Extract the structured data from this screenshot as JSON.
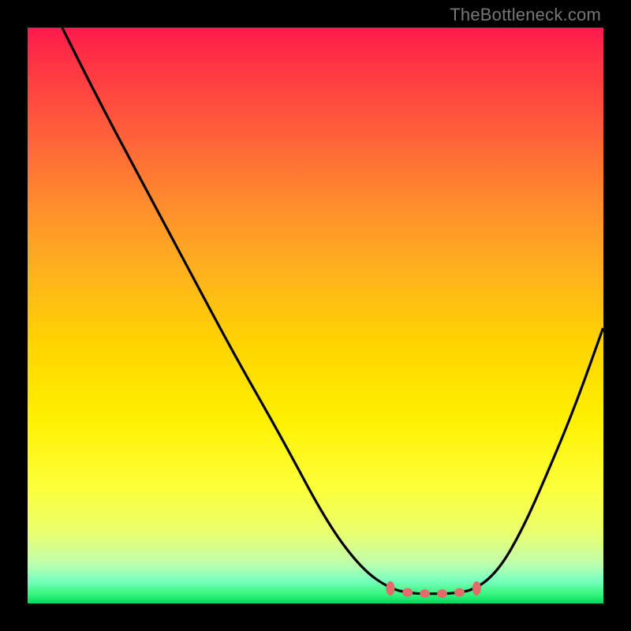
{
  "watermark": "TheBottleneck.com",
  "colors": {
    "background": "#000000",
    "gradient_top": "#ff1a4d",
    "gradient_bottom": "#00d85e",
    "curve_stroke": "#000000",
    "marker_fill": "#e46b6b"
  },
  "chart_data": {
    "type": "line",
    "title": "",
    "xlabel": "",
    "ylabel": "",
    "xlim": [
      0,
      100
    ],
    "ylim": [
      0,
      100
    ],
    "series": [
      {
        "name": "curve",
        "x": [
          6,
          12,
          20,
          28,
          36,
          44,
          52,
          58,
          63,
          67,
          70,
          74,
          78,
          82,
          86,
          90,
          95,
          100
        ],
        "y": [
          100,
          88,
          73,
          58,
          43,
          29,
          14,
          6,
          2.5,
          1.7,
          1.7,
          1.7,
          2.5,
          6,
          13,
          22,
          34,
          48
        ]
      }
    ],
    "markers": [
      {
        "x": 63,
        "y": 2.6
      },
      {
        "x": 66,
        "y": 1.9
      },
      {
        "x": 69,
        "y": 1.7
      },
      {
        "x": 72,
        "y": 1.7
      },
      {
        "x": 75,
        "y": 1.9
      },
      {
        "x": 78,
        "y": 2.6
      }
    ]
  }
}
